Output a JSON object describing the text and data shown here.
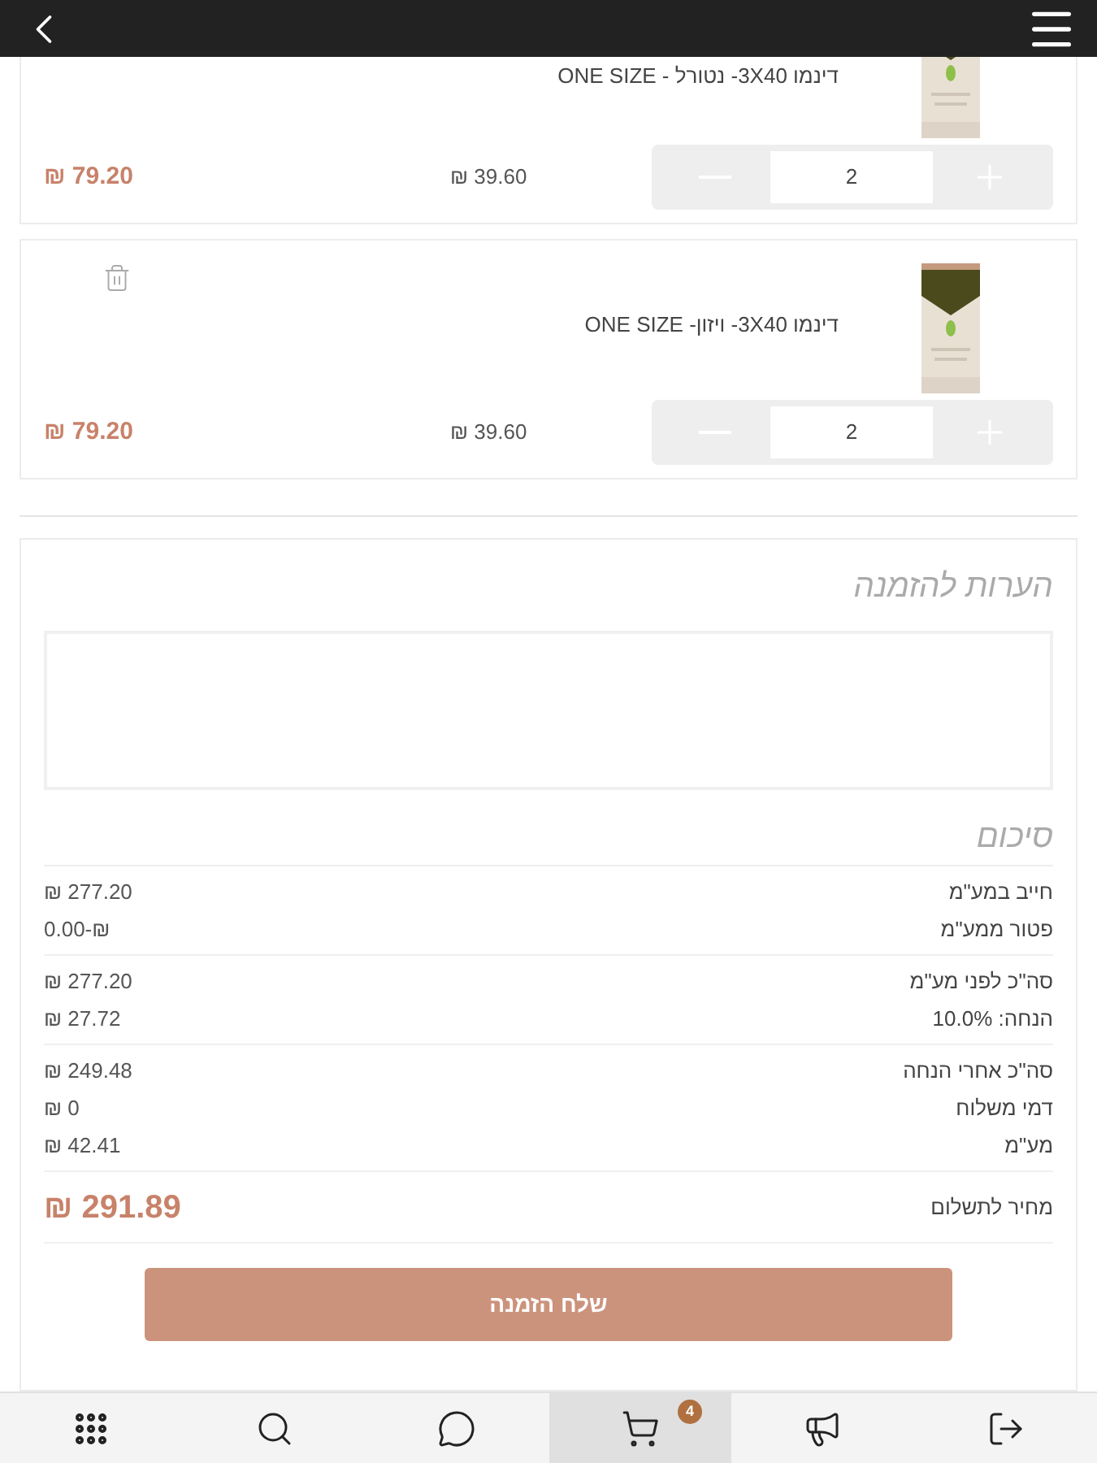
{
  "cart_items": [
    {
      "name": "דינמו 3X40- נטורל - ONE SIZE",
      "unit_price": "₪ 39.60",
      "total": "₪ 79.20",
      "quantity": "2",
      "deletable": false,
      "cut_top": true
    },
    {
      "name": "דינמו 3X40- ויזון- ONE SIZE",
      "unit_price": "₪ 39.60",
      "total": "₪ 79.20",
      "quantity": "2",
      "deletable": true,
      "cut_top": false
    }
  ],
  "notes": {
    "title": "הערות להזמנה"
  },
  "summary": {
    "title": "סיכום",
    "groups": [
      [
        {
          "label": "חייב במע\"מ",
          "value": "₪ 277.20"
        },
        {
          "label": "פטור ממע\"מ",
          "value": "0.00-₪"
        }
      ],
      [
        {
          "label": "סה\"כ לפני מע\"מ",
          "value": "₪ 277.20"
        },
        {
          "label": "הנחה: 10.0%",
          "value": "₪ 27.72"
        }
      ],
      [
        {
          "label": "סה\"כ אחרי הנחה",
          "value": "₪ 249.48"
        },
        {
          "label": "דמי משלוח",
          "value": "₪ 0"
        },
        {
          "label": "מע\"מ",
          "value": "₪ 42.41"
        }
      ]
    ],
    "total_label": "מחיר לתשלום",
    "total_value": "₪ 291.89"
  },
  "submit_button": "שלח הזמנה",
  "nav": [
    {
      "kind": "grid",
      "selected": false
    },
    {
      "kind": "search",
      "selected": false
    },
    {
      "kind": "chat",
      "selected": false
    },
    {
      "kind": "cart",
      "selected": true,
      "badge": "4"
    },
    {
      "kind": "megaphone",
      "selected": false
    },
    {
      "kind": "logout",
      "selected": false
    }
  ]
}
